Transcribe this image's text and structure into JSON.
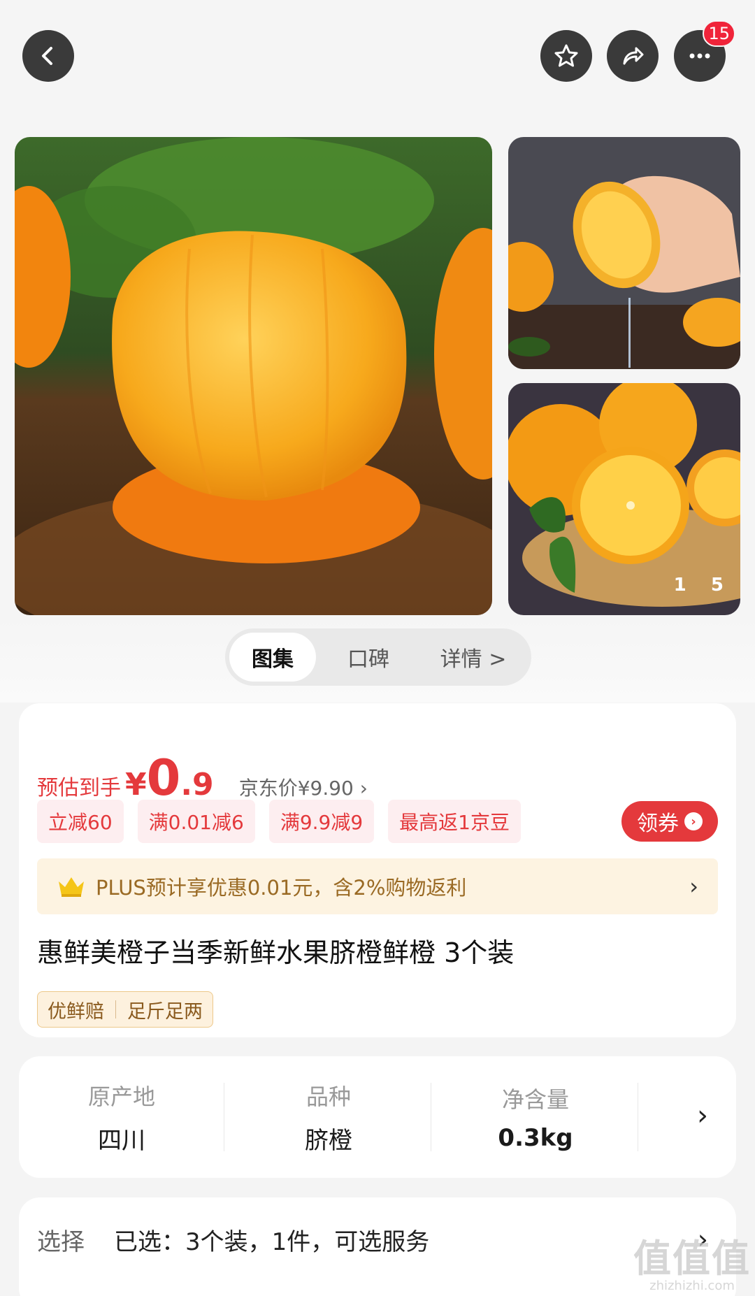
{
  "header": {
    "notification_count": "15",
    "icons": [
      "back-arrow-icon",
      "star-icon",
      "share-icon",
      "more-icon"
    ]
  },
  "gallery": {
    "page_current": "1",
    "page_total": "5"
  },
  "tabs": [
    {
      "label": "图集",
      "active": true
    },
    {
      "label": "口碑",
      "active": false
    },
    {
      "label": "详情 >",
      "active": false
    }
  ],
  "price": {
    "label": "预估到手",
    "yen": "¥",
    "integer": "0",
    "decimal": ".9",
    "jd_price": "京东价¥9.90 ›"
  },
  "coupons": [
    "立减60",
    "满0.01减6",
    "满9.9减9",
    "最高返1京豆"
  ],
  "get_coupon_label": "领券",
  "plus": {
    "text": "PLUS预计享优惠0.01元，含2%购物返利",
    "chevron": "›"
  },
  "product_title": "惠鲜美橙子当季新鲜水果脐橙鲜橙 3个装",
  "tags": [
    "优鲜赔",
    "足斤足两"
  ],
  "attributes": [
    {
      "key": "原产地",
      "value": "四川"
    },
    {
      "key": "品种",
      "value": "脐橙"
    },
    {
      "key": "净含量",
      "value": "0.3kg"
    }
  ],
  "selection": {
    "label": "选择",
    "value": "已选：3个装，1件，可选服务"
  },
  "watermark": {
    "big": "值值值",
    "small": "zhizhizhi.com"
  },
  "colors": {
    "accent_red": "#e4393c",
    "badge_red": "#f0243a",
    "plus_gold": "#9a6a24"
  }
}
